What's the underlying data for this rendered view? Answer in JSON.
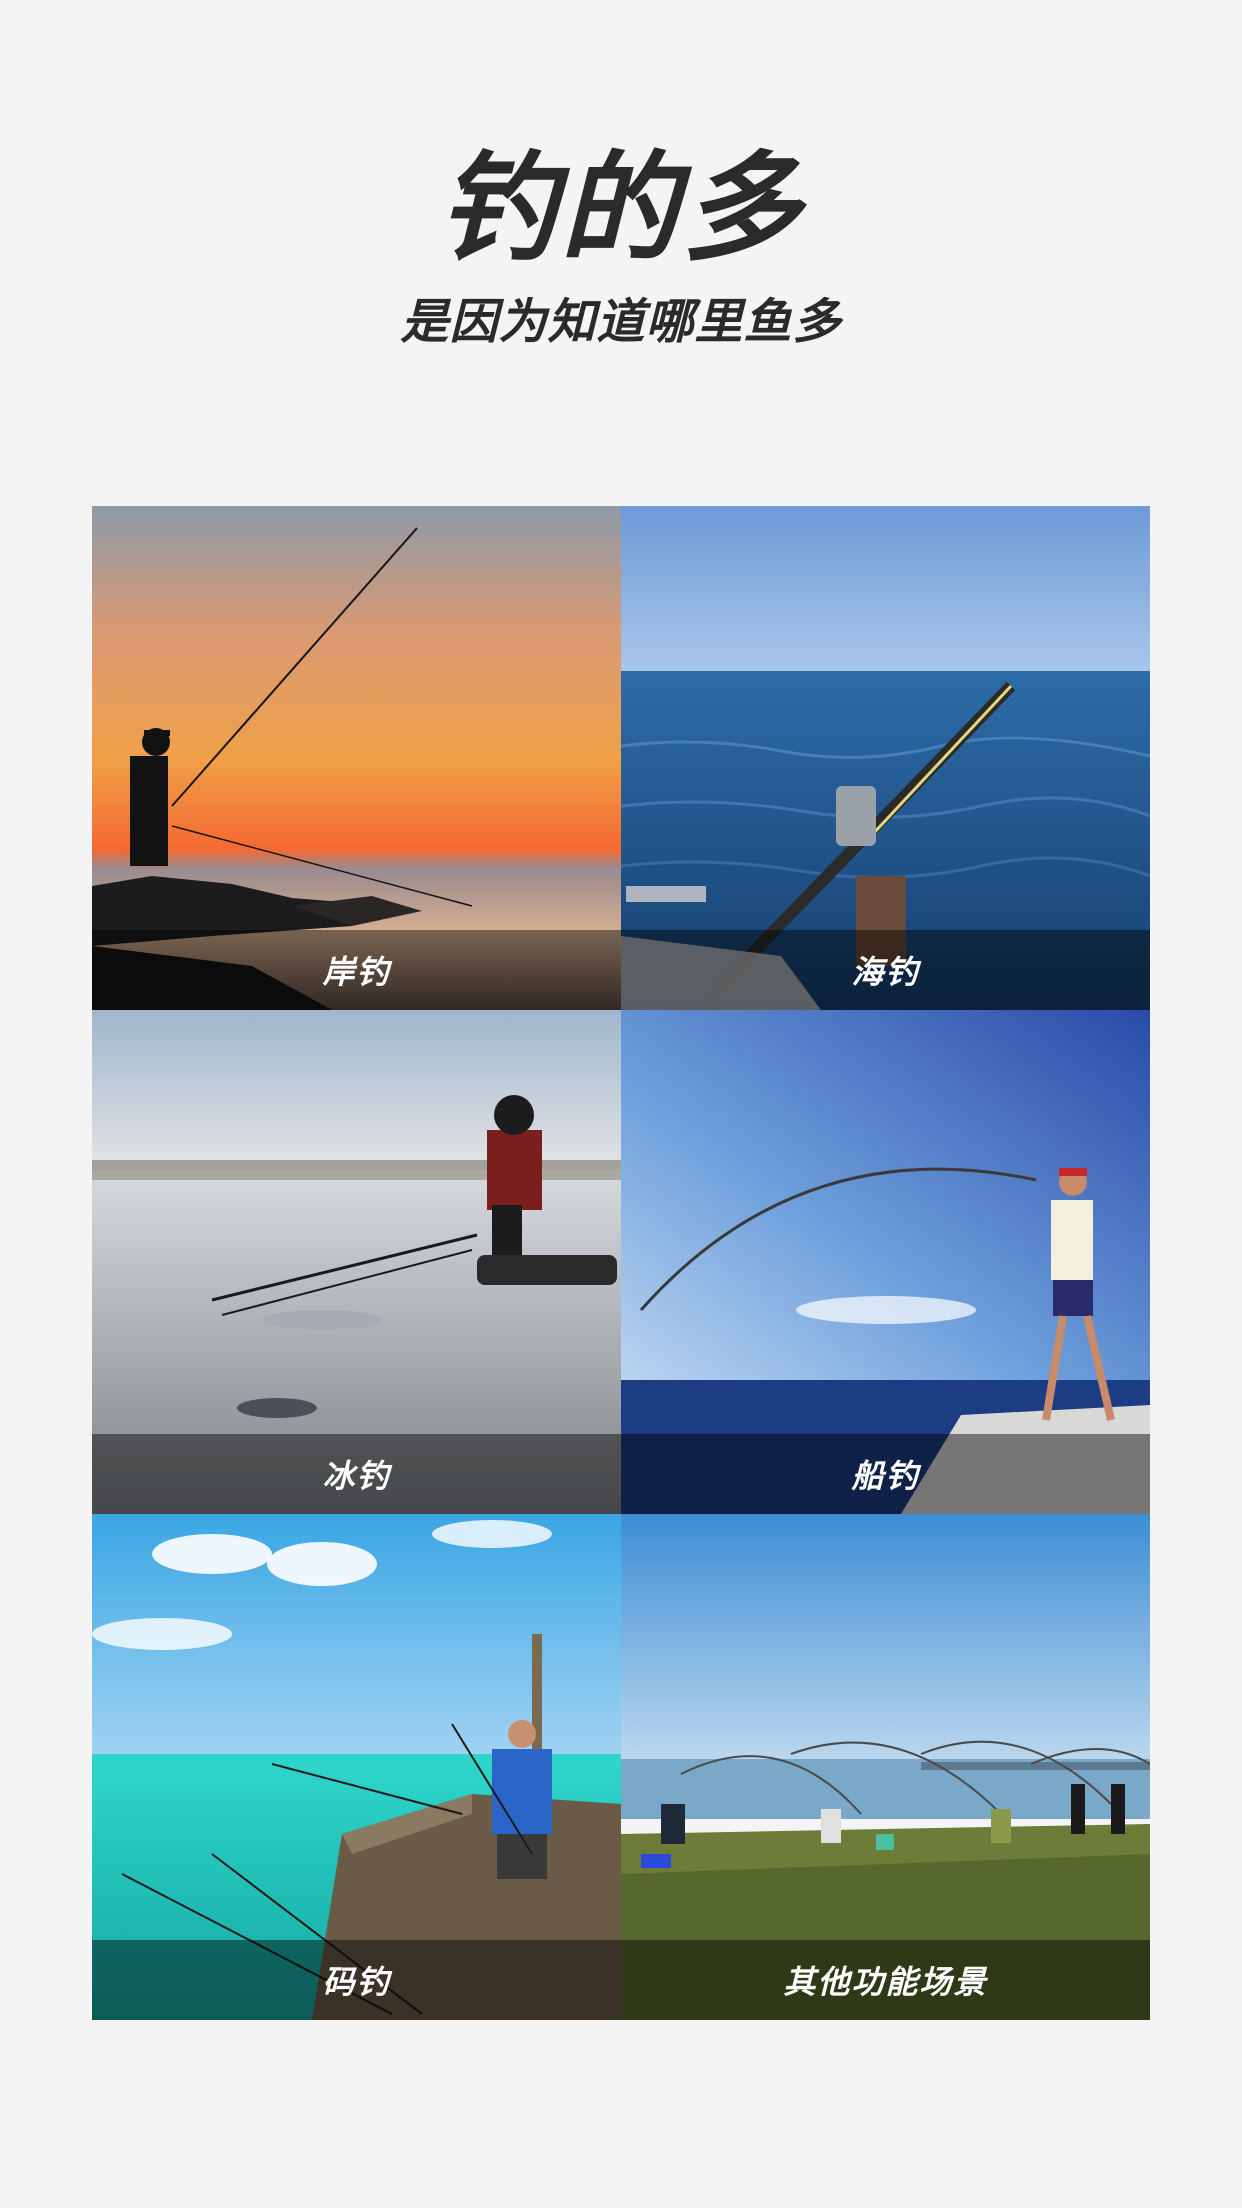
{
  "header": {
    "title": "钓的多",
    "subtitle": "是因为知道哪里鱼多"
  },
  "scenes": [
    {
      "label": "岸钓"
    },
    {
      "label": "海钓"
    },
    {
      "label": "冰钓"
    },
    {
      "label": "船钓"
    },
    {
      "label": "码钓"
    },
    {
      "label": "其他功能场景"
    }
  ],
  "colors": {
    "background": "#f4f4f4",
    "text": "#2a2a2a",
    "caption_text": "#ffffff"
  }
}
